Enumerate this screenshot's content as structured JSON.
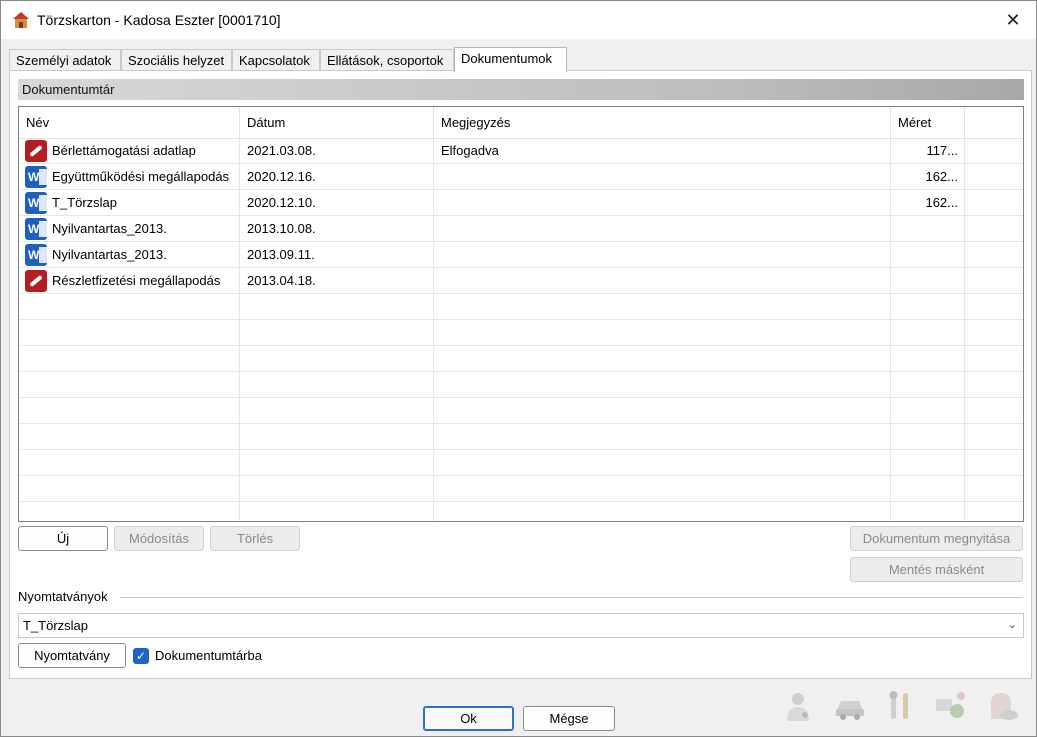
{
  "window": {
    "title": "Törzskarton - Kadosa Eszter [0001710]",
    "close_symbol": "✕"
  },
  "tabs": [
    {
      "label": "Személyi adatok",
      "active": false
    },
    {
      "label": "Szociális helyzet",
      "active": false
    },
    {
      "label": "Kapcsolatok",
      "active": false
    },
    {
      "label": "Ellátások, csoportok",
      "active": false
    },
    {
      "label": "Dokumentumok",
      "active": true
    }
  ],
  "library": {
    "header": "Dokumentumtár",
    "columns": {
      "name": "Név",
      "date": "Dátum",
      "note": "Megjegyzés",
      "size": "Méret"
    },
    "rows": [
      {
        "icon": "pdf-icon",
        "name": "Bérlettámogatási adatlap",
        "date": "2021.03.08.",
        "note": "Elfogadva",
        "size": "117..."
      },
      {
        "icon": "word-icon",
        "name": "Együttműködési megállapodás",
        "date": "2020.12.16.",
        "note": "",
        "size": "162..."
      },
      {
        "icon": "word-icon",
        "name": "T_Törzslap",
        "date": "2020.12.10.",
        "note": "",
        "size": "162..."
      },
      {
        "icon": "word-icon",
        "name": "Nyilvantartas_2013.",
        "date": "2013.10.08.",
        "note": "",
        "size": ""
      },
      {
        "icon": "word-icon",
        "name": "Nyilvantartas_2013.",
        "date": "2013.09.11.",
        "note": "",
        "size": ""
      },
      {
        "icon": "pdf-icon",
        "name": "Részletfizetési megállapodás",
        "date": "2013.04.18.",
        "note": "",
        "size": ""
      }
    ],
    "buttons": {
      "new": "Új",
      "modify": "Módosítás",
      "delete": "Törlés",
      "open": "Dokumentum megnyitása",
      "save_as": "Mentés másként"
    }
  },
  "print": {
    "group_label": "Nyomtatványok",
    "selected_form": "T_Törzslap",
    "print_button": "Nyomtatvány",
    "to_library_label": "Dokumentumtárba",
    "to_library_checked": true,
    "check_symbol": "✓",
    "chevron_symbol": "⌄"
  },
  "footer": {
    "ok": "Ok",
    "cancel": "Mégse"
  },
  "colors": {
    "accent": "#1e63c8",
    "word_icon": "#1e5fbf",
    "pdf_icon": "#b51d22"
  }
}
